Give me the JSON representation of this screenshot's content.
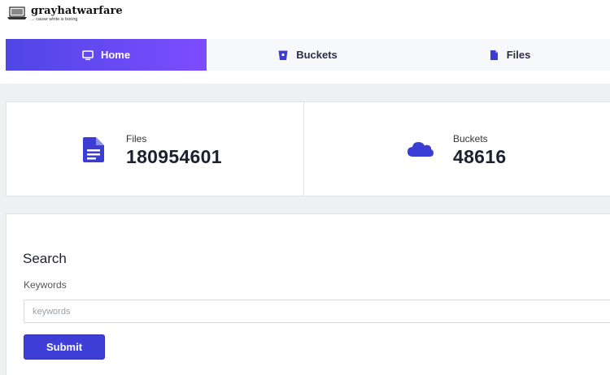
{
  "brand": {
    "name": "grayhatwarfare",
    "tagline": "... cause white is boring"
  },
  "nav": {
    "tabs": [
      {
        "label": "Home",
        "icon": "monitor-icon",
        "active": true
      },
      {
        "label": "Buckets",
        "icon": "bucket-icon",
        "active": false
      },
      {
        "label": "Files",
        "icon": "file-icon",
        "active": false
      }
    ]
  },
  "stats": {
    "files": {
      "label": "Files",
      "value": "180954601",
      "icon": "document-icon"
    },
    "buckets": {
      "label": "Buckets",
      "value": "48616",
      "icon": "cloud-icon"
    }
  },
  "search": {
    "title": "Search",
    "keywords_label": "Keywords",
    "keywords_placeholder": "keywords",
    "keywords_value": "",
    "submit_label": "Submit"
  },
  "colors": {
    "accent": "#4f46e5",
    "accent_gradient_end": "#7c4dff",
    "icon_blue": "#3b3bd6",
    "button": "#3f3fd8"
  }
}
